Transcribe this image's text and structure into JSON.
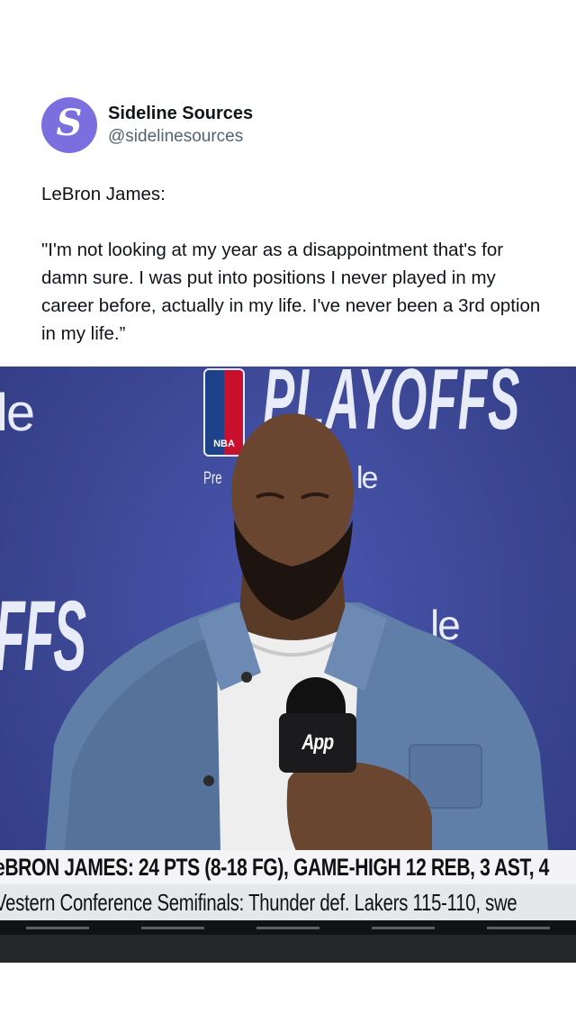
{
  "account": {
    "display_name": "Sideline Sources",
    "handle": "@sidelinesources",
    "avatar_letter": "S",
    "avatar_color": "#7b6fe0"
  },
  "tweet": {
    "line1": "LeBron James:",
    "line2": "\"I'm not looking at my year as a disappointment that's for damn sure. I was put into positions I never played in my career before, actually in my life. I've never been a 3rd option in my life.”"
  },
  "media": {
    "backdrop": {
      "le_left": "le",
      "playoffs": "PLAYOFFS",
      "ffs_left": "FFS",
      "presented": "Pre",
      "le_mid": "le",
      "le_right": "le",
      "nba_logo_text": "NBA"
    },
    "mic_flag": "App",
    "ticker": {
      "headline": "eBRON JAMES: 24 PTS (8-18 FG), GAME-HIGH 12 REB, 3 AST, 4",
      "subline": "Vestern Conference Semifinals: Thunder def. Lakers 115-110, swe"
    }
  }
}
